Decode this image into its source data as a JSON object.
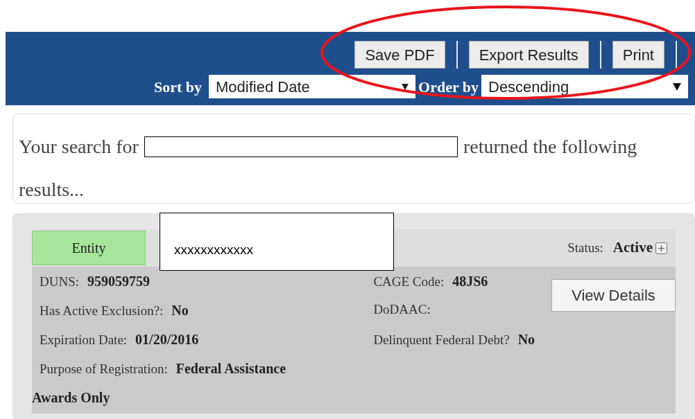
{
  "toolbar": {
    "buttons": [
      "Save PDF",
      "Export Results",
      "Print"
    ]
  },
  "sort": {
    "label": "Sort by",
    "value": "Modified Date"
  },
  "order": {
    "label": "Order by",
    "value": "Descending"
  },
  "search_summary": {
    "prefix": "Your search for",
    "suffix": "returned the following",
    "continuation": "results..."
  },
  "result": {
    "type": "Entity",
    "name": "xxxxxxxxxxxx",
    "status_label": "Status:",
    "status_value": "Active",
    "left_fields": [
      {
        "label": "DUNS:",
        "value": "959059759"
      },
      {
        "label": "Has Active Exclusion?:",
        "value": "No"
      },
      {
        "label": "Expiration Date:",
        "value": "01/20/2016"
      },
      {
        "label": "Purpose of Registration:",
        "value": "Federal Assistance"
      }
    ],
    "right_fields": [
      {
        "label": "CAGE Code:",
        "value": "48JS6"
      },
      {
        "label": "DoDAAC:"
      },
      {
        "label": "Delinquent Federal Debt?",
        "value": "No"
      }
    ],
    "continuation": "Awards Only",
    "button": "View Details"
  }
}
